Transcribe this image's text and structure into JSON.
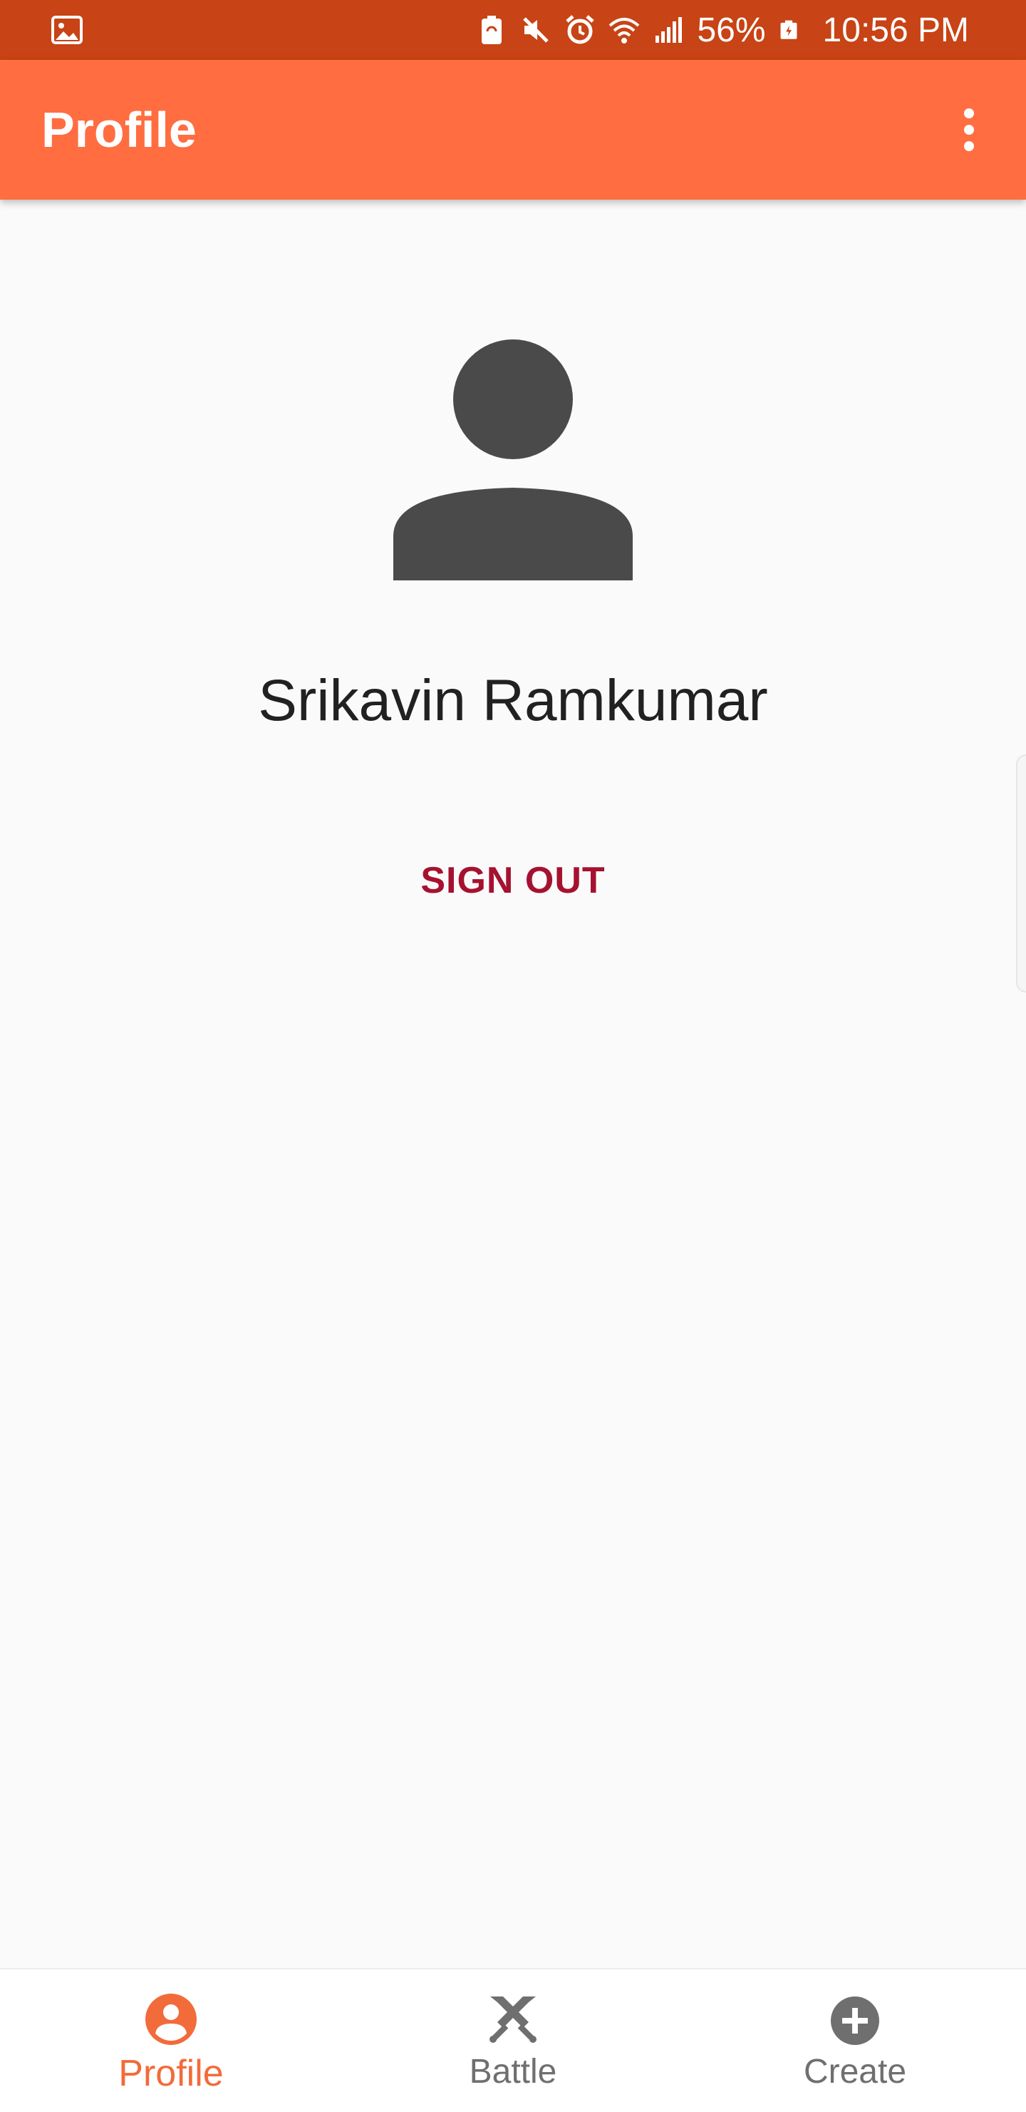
{
  "status_bar": {
    "battery": "56%",
    "time": "10:56 PM",
    "icons": [
      "image-icon",
      "battery-saver-icon",
      "mute-icon",
      "alarm-icon",
      "wifi-icon",
      "signal-icon",
      "battery-icon"
    ]
  },
  "app_bar": {
    "title": "Profile",
    "menu_icon": "more-vertical-icon",
    "color": "#ff6d40"
  },
  "profile": {
    "avatar_icon": "person-icon",
    "name": "Srikavin Ramkumar",
    "sign_out_label": "SIGN OUT",
    "sign_out_color": "#a5122f"
  },
  "bottom_nav": {
    "items": [
      {
        "label": "Profile",
        "icon": "account-circle-icon",
        "active": true
      },
      {
        "label": "Battle",
        "icon": "crossed-swords-icon",
        "active": false
      },
      {
        "label": "Create",
        "icon": "add-circle-icon",
        "active": false
      }
    ],
    "active_color": "#f26b3a",
    "inactive_color": "#6f6f6f"
  }
}
